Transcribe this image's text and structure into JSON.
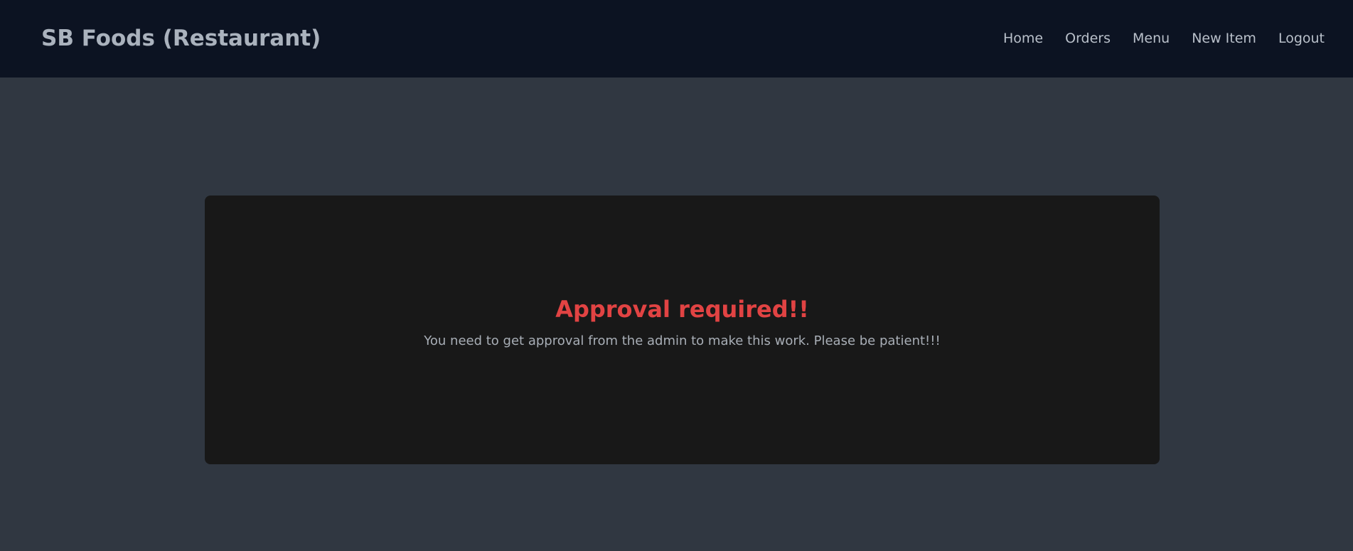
{
  "header": {
    "brand": "SB Foods (Restaurant)",
    "nav": [
      {
        "label": "Home"
      },
      {
        "label": "Orders"
      },
      {
        "label": "Menu"
      },
      {
        "label": "New Item"
      },
      {
        "label": "Logout"
      }
    ]
  },
  "main": {
    "card": {
      "title": "Approval required!!",
      "message": "You need to get approval from the admin to make this work. Please be patient!!!"
    }
  },
  "colors": {
    "navbar_bg": "#0c1322",
    "page_bg": "#303741",
    "card_bg": "#181818",
    "title_red": "#e14343",
    "text_muted": "#a8aeb6"
  }
}
